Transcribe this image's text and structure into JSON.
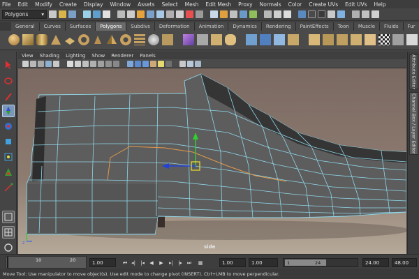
{
  "menubar": [
    "File",
    "Edit",
    "Modify",
    "Create",
    "Display",
    "Window",
    "Assets",
    "Select",
    "Mesh",
    "Edit Mesh",
    "Proxy",
    "Normals",
    "Color",
    "Create UVs",
    "Edit UVs",
    "Help"
  ],
  "status_line": {
    "mode": "Polygons"
  },
  "shelf_tabs": [
    {
      "label": "General",
      "active": false
    },
    {
      "label": "Curves",
      "active": false
    },
    {
      "label": "Surfaces",
      "active": false
    },
    {
      "label": "Polygons",
      "active": true
    },
    {
      "label": "Subdivs",
      "active": false
    },
    {
      "label": "Deformation",
      "active": false
    },
    {
      "label": "Animation",
      "active": false
    },
    {
      "label": "Dynamics",
      "active": false
    },
    {
      "label": "Rendering",
      "active": false
    },
    {
      "label": "PaintEffects",
      "active": false
    },
    {
      "label": "Toon",
      "active": false
    },
    {
      "label": "Muscle",
      "active": false
    },
    {
      "label": "Fluids",
      "active": false
    },
    {
      "label": "Fur",
      "active": false
    }
  ],
  "panel_menu": [
    "View",
    "Shading",
    "Lighting",
    "Show",
    "Renderer",
    "Panels"
  ],
  "viewport": {
    "camera": "side"
  },
  "right_tabs": [
    "Attribute Editor",
    "Channel Box / Layer Editor"
  ],
  "time_slider": {
    "tick_labels": [
      "10",
      "20"
    ],
    "current_time": "1.00",
    "start_time": "1.00",
    "playback_start": "1.00",
    "range_start": "1",
    "range_end": "24",
    "playback_end": "24.00",
    "end_time": "48.00"
  },
  "help_line": "Move Tool: Use manipulator to move object(s). Use edit mode to change pivot (INSERT).  Ctrl+LMB to move perpendicular."
}
